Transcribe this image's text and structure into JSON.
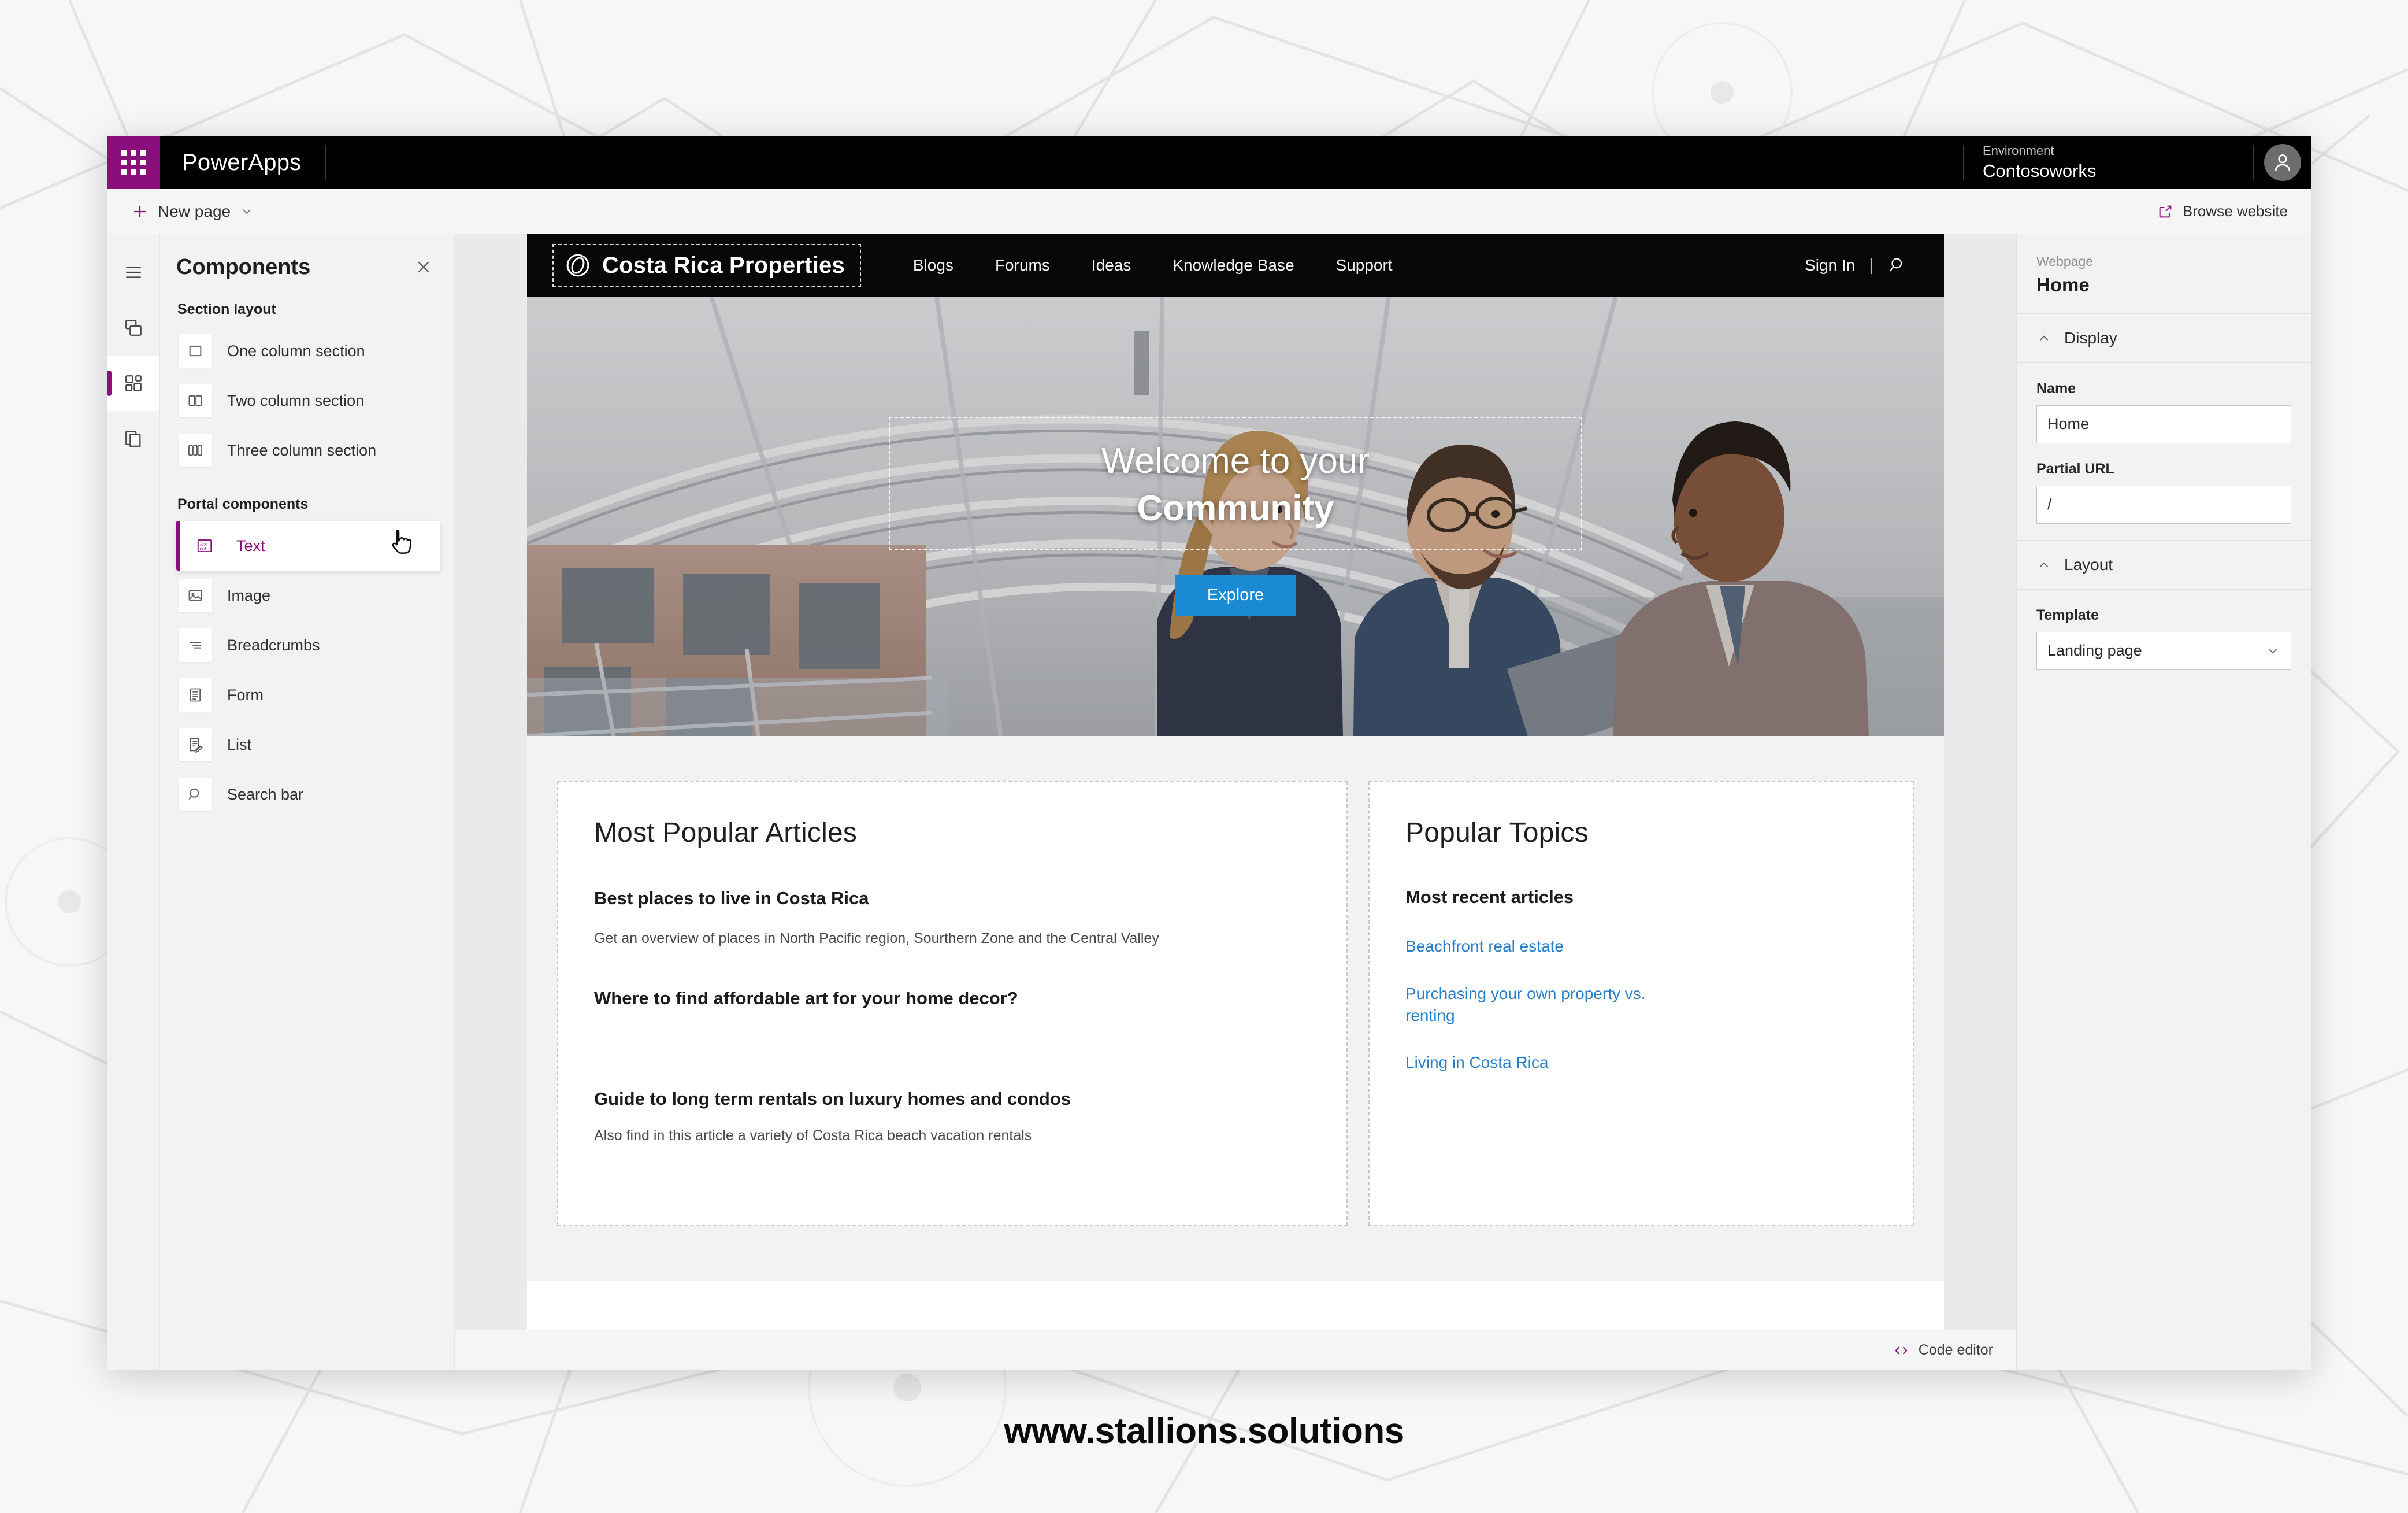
{
  "window": {
    "topbar": {
      "waffle_icon": "waffle-grid-icon",
      "app_title": "PowerApps",
      "environment_label": "Environment",
      "environment_name": "Contosoworks",
      "avatar_icon": "user-avatar-icon"
    },
    "commandbar": {
      "new_page_label": "New page",
      "new_page_icon": "plus-icon",
      "new_page_chevron": "chevron-down-icon",
      "browse_website_label": "Browse website",
      "browse_website_icon": "open-in-new-window-icon"
    }
  },
  "rail": {
    "items": [
      {
        "name": "menu",
        "icon": "hamburger-menu-icon",
        "active": false
      },
      {
        "name": "pages",
        "icon": "pages-stack-icon",
        "active": false
      },
      {
        "name": "components",
        "icon": "components-grid-icon",
        "active": true
      },
      {
        "name": "templates",
        "icon": "page-templates-icon",
        "active": false
      }
    ]
  },
  "components_panel": {
    "title": "Components",
    "close_icon": "close-icon",
    "groups": [
      {
        "title": "Section layout",
        "items": [
          {
            "label": "One column section",
            "icon": "one-column-icon",
            "selected": false
          },
          {
            "label": "Two column section",
            "icon": "two-column-icon",
            "selected": false
          },
          {
            "label": "Three column section",
            "icon": "three-column-icon",
            "selected": false
          }
        ]
      },
      {
        "title": "Portal components",
        "items": [
          {
            "label": "Text",
            "icon": "text-abc-icon",
            "selected": true
          },
          {
            "label": "Image",
            "icon": "image-icon",
            "selected": false
          },
          {
            "label": "Breadcrumbs",
            "icon": "breadcrumbs-icon",
            "selected": false
          },
          {
            "label": "Form",
            "icon": "form-icon",
            "selected": false
          },
          {
            "label": "List",
            "icon": "list-edit-icon",
            "selected": false
          },
          {
            "label": "Search bar",
            "icon": "search-icon",
            "selected": false
          }
        ]
      }
    ]
  },
  "canvas": {
    "site_nav": {
      "brand": "Costa Rica Properties",
      "brand_icon": "circle-swirl-logo-icon",
      "links": [
        "Blogs",
        "Forums",
        "Ideas",
        "Knowledge Base",
        "Support"
      ],
      "sign_in": "Sign In",
      "separator": "|",
      "search_icon": "search-icon"
    },
    "hero": {
      "line1": "Welcome to your",
      "line2": "Community",
      "button_label": "Explore",
      "button_color": "#1a8ad4"
    },
    "cards": [
      {
        "heading": "Most Popular Articles",
        "articles": [
          {
            "title": "Best places to live in Costa Rica",
            "desc": "Get an overview of places in North Pacific region, Sourthern Zone and the Central Valley"
          },
          {
            "title": "Where to find affordable art for your home decor?",
            "desc": ""
          },
          {
            "title": "Guide to long term rentals on luxury homes and condos",
            "desc": "Also find in this article  a variety of Costa Rica beach vacation rentals"
          }
        ]
      },
      {
        "heading": "Popular Topics",
        "subheading": "Most recent articles",
        "links": [
          "Beachfront real estate",
          "Purchasing your own property vs. renting",
          "Living in Costa Rica"
        ],
        "link_color": "#2a7fc9"
      }
    ],
    "footer": {
      "code_editor_label": "Code editor",
      "code_editor_icon": "code-brackets-icon"
    }
  },
  "properties": {
    "kind_label": "Webpage",
    "page_name": "Home",
    "sections": [
      {
        "title": "Display",
        "chevron": "chevron-up-icon",
        "fields": [
          {
            "label": "Name",
            "type": "input",
            "value": "Home"
          },
          {
            "label": "Partial URL",
            "type": "input",
            "value": "/"
          }
        ]
      },
      {
        "title": "Layout",
        "chevron": "chevron-up-icon",
        "fields": [
          {
            "label": "Template",
            "type": "select",
            "value": "Landing page",
            "chevron": "chevron-down-icon"
          }
        ]
      }
    ]
  },
  "watermark": "www.stallions.solutions",
  "theme": {
    "brand_purple": "#8a0f7d",
    "topbar_black": "#000000",
    "canvas_gray": "#eaeaea",
    "panel_gray": "#f3f2f1"
  }
}
